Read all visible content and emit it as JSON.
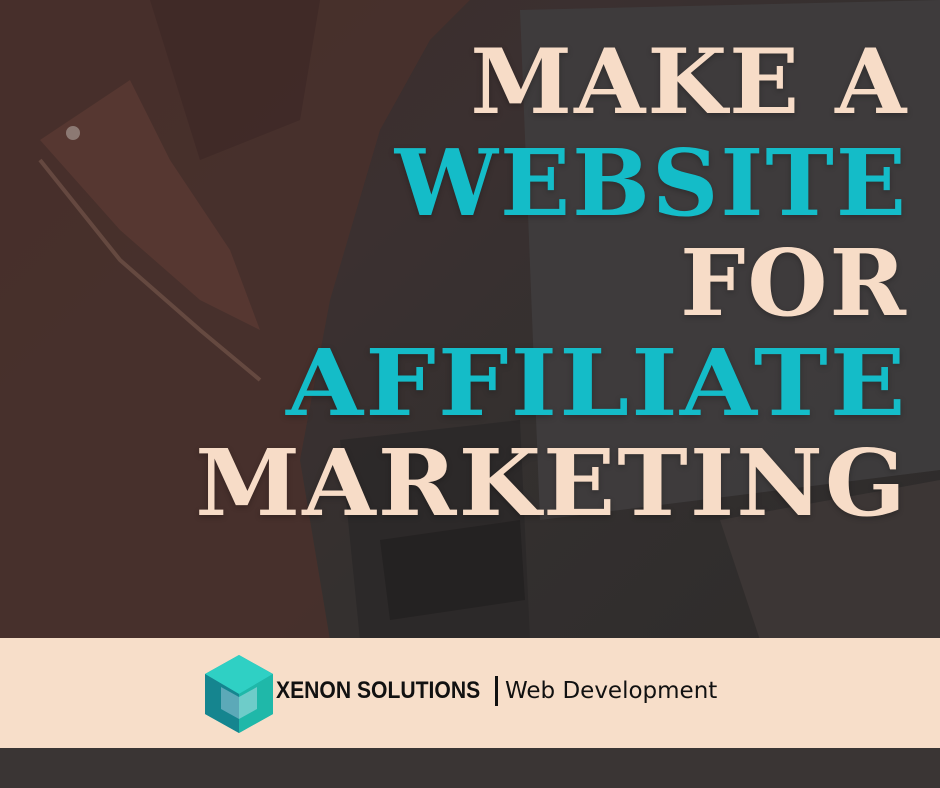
{
  "headline": {
    "line1": "MAKE A",
    "line2": "WEBSITE",
    "line3": "FOR",
    "line4": "AFFILIATE",
    "line5": "MARKETING"
  },
  "brand": {
    "name": "XENON SOLUTIONS",
    "tagline": "Web Development",
    "logo_icon": "hexagon-cube-logo-icon"
  },
  "colors": {
    "cream": "#f7dcc7",
    "teal": "#14bcc8",
    "background_dark": "#332d2c",
    "brand_bar": "#f7dec9"
  }
}
